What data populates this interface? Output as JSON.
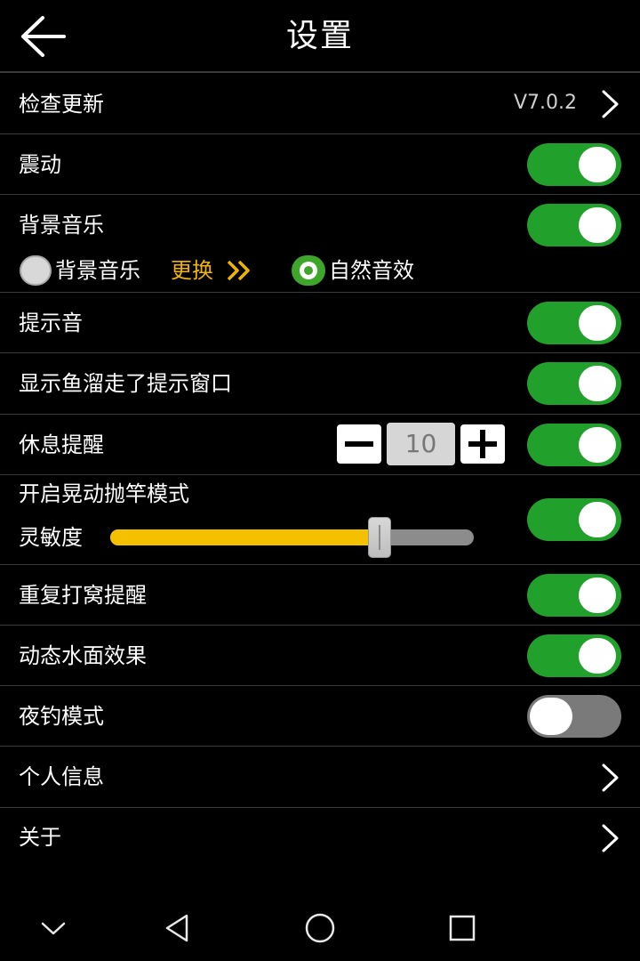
{
  "header": {
    "title": "设置",
    "back_icon": "arrow-left-icon"
  },
  "rows": {
    "check_update": {
      "label": "检查更新",
      "version": "V7.0.2"
    },
    "vibration": {
      "label": "震动",
      "on": true
    },
    "bg_music": {
      "label": "背景音乐",
      "on": true
    },
    "bg_music_options": {
      "option_bg_music": "背景音乐",
      "change_label": "更换",
      "option_nature": "自然音效",
      "selected": "自然音效"
    },
    "prompt_sound": {
      "label": "提示音",
      "on": true
    },
    "fish_escape": {
      "label": "显示鱼溜走了提示窗口",
      "on": true
    },
    "rest_reminder": {
      "label": "休息提醒",
      "value": "10",
      "on": true
    },
    "shake_cast": {
      "label": "开启晃动抛竿模式",
      "sensitivity_label": "灵敏度",
      "sensitivity_fraction": 0.74,
      "on": true
    },
    "repeat_nest": {
      "label": "重复打窝提醒",
      "on": true
    },
    "water_effect": {
      "label": "动态水面效果",
      "on": true
    },
    "night_mode": {
      "label": "夜钓模式",
      "on": false
    },
    "personal_info": {
      "label": "个人信息"
    },
    "about": {
      "label": "关于"
    }
  },
  "colors": {
    "background": "#000000",
    "toggle_on": "#21a12b",
    "toggle_off": "#7a7a7a",
    "accent_yellow": "#f0b400",
    "divider": "#3a3a3a"
  },
  "navbar": {
    "icons": [
      "chevron-down-icon",
      "back-triangle-icon",
      "home-circle-icon",
      "recents-square-icon"
    ]
  }
}
